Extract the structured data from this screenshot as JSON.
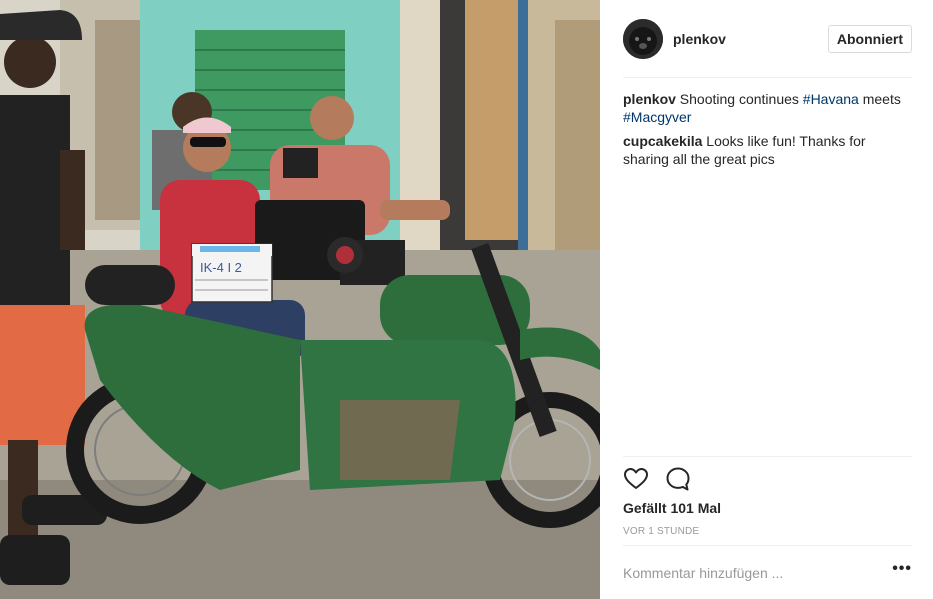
{
  "post": {
    "username": "plenkov",
    "follow_label": "Abonniert",
    "caption": {
      "author": "plenkov",
      "text_before": "Shooting continues ",
      "hashtag1": "#Havana",
      "text_middle": " meets",
      "hashtag2": "#Macgyver"
    },
    "comments": [
      {
        "author": "cupcakekila",
        "text": "Looks like fun! Thanks for sharing all the great pics"
      }
    ],
    "likes_text": "Gefällt 101 Mal",
    "time_text": "VOR 1 STUNDE",
    "comment_placeholder": "Kommentar hinzufügen ...",
    "more_label": "•••"
  },
  "photo": {
    "clapper_line1": "IK-4  I  2"
  },
  "icons": {
    "like": "heart-icon",
    "comment": "speech-bubble-icon",
    "more": "ellipsis-icon"
  },
  "colors": {
    "link": "#003569",
    "muted": "#999999",
    "divider": "#efefef",
    "sidecar_green": "#2e6e3c"
  }
}
